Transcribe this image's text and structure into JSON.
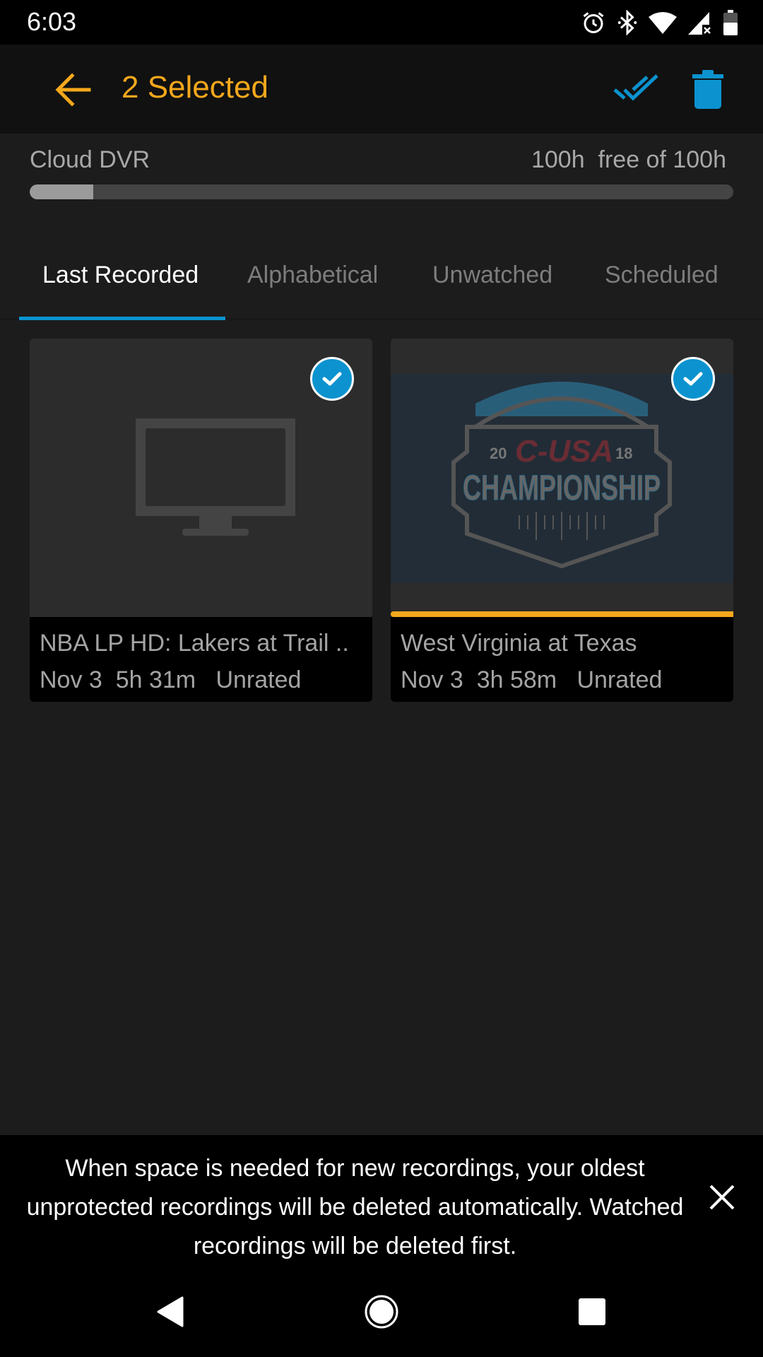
{
  "status_bar": {
    "time": "6:03",
    "icons": [
      "alarm-icon",
      "bluetooth-icon",
      "wifi-icon",
      "cell-signal-no-data-icon",
      "battery-icon"
    ]
  },
  "app_bar": {
    "title": "2 Selected",
    "back_icon": "arrow-left-icon",
    "actions": [
      {
        "name": "select-all",
        "icon": "double-check-icon"
      },
      {
        "name": "delete",
        "icon": "trash-icon"
      }
    ]
  },
  "storage": {
    "label": "Cloud DVR",
    "free_text": "100h  free of 100h",
    "bar_fill_percent": 9
  },
  "tabs": [
    {
      "label": "Last Recorded",
      "active": true
    },
    {
      "label": "Alphabetical",
      "active": false
    },
    {
      "label": "Unwatched",
      "active": false
    },
    {
      "label": "Scheduled",
      "active": false
    }
  ],
  "recordings": [
    {
      "title": "NBA LP HD: Lakers at Trail ..",
      "meta": "Nov 3  5h 31m   Unrated",
      "thumbnail": "tv-placeholder-icon",
      "selected": true,
      "watch_progress_percent": 0
    },
    {
      "title": "West Virginia at Texas",
      "meta": "Nov 3  3h 58m   Unrated",
      "thumbnail": "C-USA 2018 Championship logo",
      "logo_text": {
        "year_left": "20",
        "brand": "C-USA",
        "year_right": "18",
        "title": "CHAMPIONSHIP"
      },
      "selected": true,
      "watch_progress_percent": 100
    }
  ],
  "banner": {
    "message": "When space is needed for new recordings, your oldest unprotected recordings will be deleted automatically. Watched recordings will be deleted first.",
    "close_icon": "close-icon"
  },
  "nav_bar": {
    "buttons": [
      "back-triangle-icon",
      "home-circle-icon",
      "recents-square-icon"
    ]
  },
  "colors": {
    "accent_orange": "#f5a81c",
    "accent_blue": "#0c93cf",
    "background": "#1c1c1c"
  }
}
